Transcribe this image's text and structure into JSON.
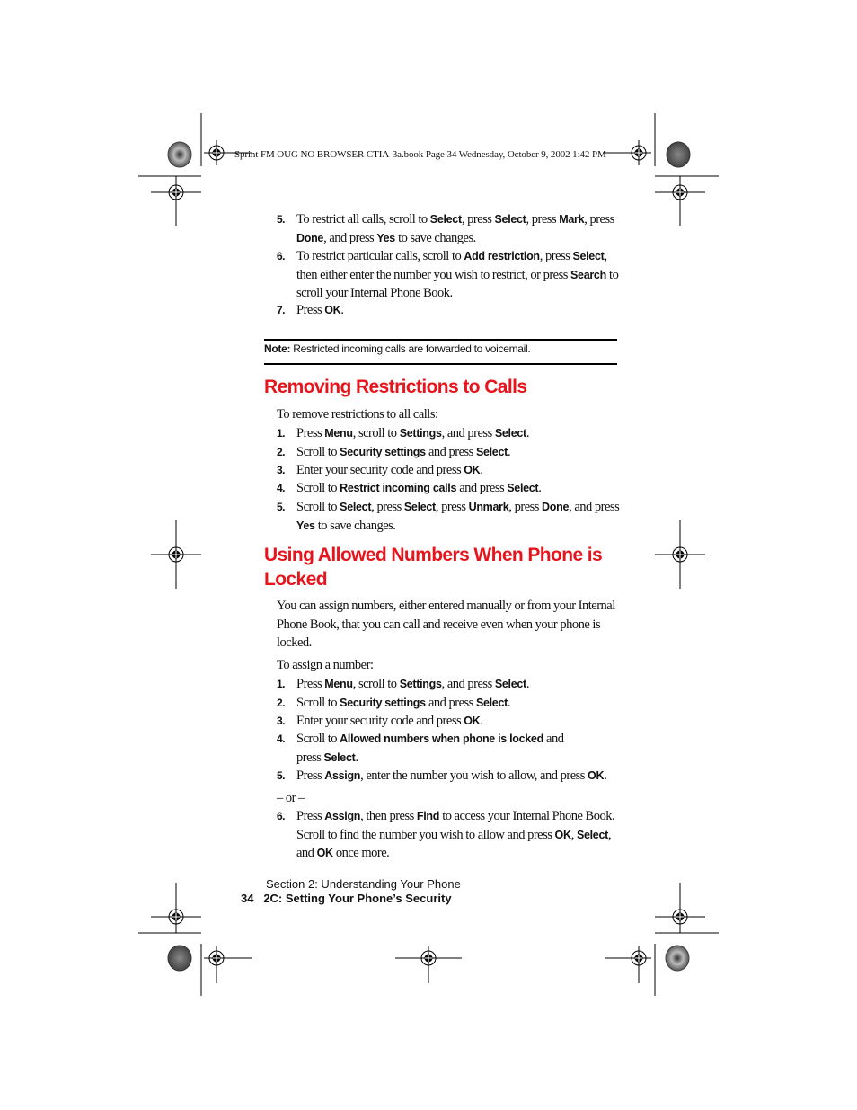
{
  "print_header": "Sprint FM OUG NO BROWSER CTIA-3a.book  Page 34  Wednesday, October 9, 2002  1:42 PM",
  "top_steps": [
    {
      "num": "5.",
      "parts": [
        {
          "t": "To restrict all calls, scroll to "
        },
        {
          "k": "Select"
        },
        {
          "t": ", press "
        },
        {
          "k": "Select"
        },
        {
          "t": ", press "
        },
        {
          "k": "Mark"
        },
        {
          "t": ", press "
        },
        {
          "k": "Done"
        },
        {
          "t": ", and press "
        },
        {
          "k": "Yes"
        },
        {
          "t": " to save changes."
        }
      ]
    },
    {
      "num": "6.",
      "parts": [
        {
          "t": "To restrict particular calls, scroll to "
        },
        {
          "k": "Add restriction"
        },
        {
          "t": ", press "
        },
        {
          "k": "Select"
        },
        {
          "t": ", then either enter the number you wish to restrict, or press "
        },
        {
          "k": "Search"
        },
        {
          "t": " to scroll your Internal Phone Book."
        }
      ]
    },
    {
      "num": "7.",
      "parts": [
        {
          "t": "Press "
        },
        {
          "k": "OK"
        },
        {
          "t": "."
        }
      ]
    }
  ],
  "note": {
    "label": "Note:",
    "text": " Restricted incoming calls are forwarded to voicemail."
  },
  "section1": {
    "title": "Removing Restrictions to Calls",
    "intro": "To remove restrictions to all calls:",
    "steps": [
      {
        "num": "1.",
        "parts": [
          {
            "t": "Press "
          },
          {
            "k": "Menu"
          },
          {
            "t": ", scroll to "
          },
          {
            "k": "Settings"
          },
          {
            "t": ", and press "
          },
          {
            "k": "Select"
          },
          {
            "t": "."
          }
        ]
      },
      {
        "num": "2.",
        "parts": [
          {
            "t": "Scroll to "
          },
          {
            "k": "Security settings"
          },
          {
            "t": " and press "
          },
          {
            "k": "Select"
          },
          {
            "t": "."
          }
        ]
      },
      {
        "num": "3.",
        "parts": [
          {
            "t": "Enter your security code and press "
          },
          {
            "k": "OK"
          },
          {
            "t": "."
          }
        ]
      },
      {
        "num": "4.",
        "parts": [
          {
            "t": "Scroll to "
          },
          {
            "k": "Restrict incoming calls"
          },
          {
            "t": " and press "
          },
          {
            "k": "Select"
          },
          {
            "t": "."
          }
        ]
      },
      {
        "num": "5.",
        "parts": [
          {
            "t": "Scroll to "
          },
          {
            "k": "Select"
          },
          {
            "t": ", press "
          },
          {
            "k": "Select"
          },
          {
            "t": ", press "
          },
          {
            "k": "Unmark"
          },
          {
            "t": ", press "
          },
          {
            "k": "Done"
          },
          {
            "t": ", and press "
          },
          {
            "k": "Yes"
          },
          {
            "t": " to save changes."
          }
        ]
      }
    ]
  },
  "section2": {
    "title": "Using Allowed Numbers When Phone is Locked",
    "intro": "You can assign numbers, either entered manually or from your Internal Phone Book, that you can call and receive even when your phone is locked.",
    "intro2": "To assign a number:",
    "steps": [
      {
        "num": "1.",
        "parts": [
          {
            "t": "Press "
          },
          {
            "k": "Menu"
          },
          {
            "t": ", scroll to "
          },
          {
            "k": "Settings"
          },
          {
            "t": ", and press "
          },
          {
            "k": "Select"
          },
          {
            "t": "."
          }
        ]
      },
      {
        "num": "2.",
        "parts": [
          {
            "t": "Scroll to "
          },
          {
            "k": "Security settings"
          },
          {
            "t": " and press "
          },
          {
            "k": "Select"
          },
          {
            "t": "."
          }
        ]
      },
      {
        "num": "3.",
        "parts": [
          {
            "t": "Enter your security code and press "
          },
          {
            "k": "OK"
          },
          {
            "t": "."
          }
        ]
      },
      {
        "num": "4.",
        "parts": [
          {
            "t": "Scroll to "
          },
          {
            "k": "Allowed numbers when phone is locked"
          },
          {
            "t": " and press "
          },
          {
            "k": "Select"
          },
          {
            "t": "."
          }
        ]
      },
      {
        "num": "5.",
        "parts": [
          {
            "t": "Press "
          },
          {
            "k": "Assign"
          },
          {
            "t": ", enter the number you wish to allow, and press "
          },
          {
            "k": "OK"
          },
          {
            "t": "."
          }
        ]
      }
    ],
    "or": "– or –",
    "step6": {
      "num": "6.",
      "parts": [
        {
          "t": "Press "
        },
        {
          "k": "Assign"
        },
        {
          "t": ", then press "
        },
        {
          "k": "Find"
        },
        {
          "t": " to access your Internal Phone Book. Scroll to find the number you wish to allow and press "
        },
        {
          "k": "OK"
        },
        {
          "t": ", "
        },
        {
          "k": "Select"
        },
        {
          "t": ", and "
        },
        {
          "k": "OK"
        },
        {
          "t": " once more."
        }
      ]
    }
  },
  "footer": {
    "section": "Section 2: Understanding Your Phone",
    "page_number": "34",
    "chapter": "2C: Setting Your Phone’s Security"
  },
  "colors": {
    "heading": "#e8141c",
    "text": "#111111"
  }
}
